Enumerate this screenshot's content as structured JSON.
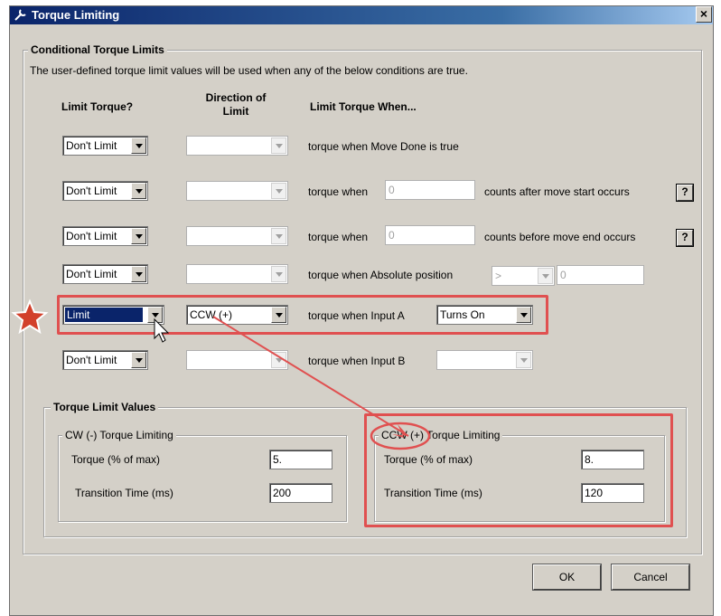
{
  "window": {
    "title": "Torque Limiting",
    "close_label": "×"
  },
  "conditional": {
    "group_title": "Conditional Torque Limits",
    "description": "The user-defined torque limit values will be used when any of the below conditions are true.",
    "headers": {
      "limit_torque": "Limit Torque?",
      "direction_line1": "Direction of",
      "direction_line2": "Limit",
      "when": "Limit Torque When..."
    },
    "rows": [
      {
        "limit": "Don't Limit",
        "direction": "",
        "prefix": "torque when Move Done is true"
      },
      {
        "limit": "Don't Limit",
        "direction": "",
        "prefix": "torque when",
        "count_value": "0",
        "suffix": "counts after move start occurs",
        "help": "?"
      },
      {
        "limit": "Don't Limit",
        "direction": "",
        "prefix": "torque when",
        "count_value": "0",
        "suffix": "counts before move end occurs",
        "help": "?"
      },
      {
        "limit": "Don't Limit",
        "direction": "",
        "prefix": "torque when Absolute position",
        "op": ">",
        "pos_value": "0"
      },
      {
        "limit": "Limit",
        "direction": "CCW (+)",
        "prefix": "torque when Input A",
        "input_state": "Turns On"
      },
      {
        "limit": "Don't Limit",
        "direction": "",
        "prefix": "torque when Input B",
        "input_state": ""
      }
    ]
  },
  "values": {
    "group_title": "Torque Limit Values",
    "cw": {
      "title": "CW (-) Torque Limiting",
      "torque_label": "Torque (% of max)",
      "torque_value": "5.",
      "time_label": "Transition Time (ms)",
      "time_value": "200"
    },
    "ccw": {
      "title": "CCW (+) Torque Limiting",
      "torque_label": "Torque (% of max)",
      "torque_value": "8.",
      "time_label": "Transition Time (ms)",
      "time_value": "120"
    }
  },
  "buttons": {
    "ok": "OK",
    "cancel": "Cancel"
  },
  "colors": {
    "highlight": "#e05050",
    "title_bar": "#0a246a",
    "dialog_bg": "#d4d0c8"
  },
  "icons": {
    "title": "wrench-icon",
    "callout": "star-icon",
    "cursor": "mouse-pointer-icon"
  }
}
